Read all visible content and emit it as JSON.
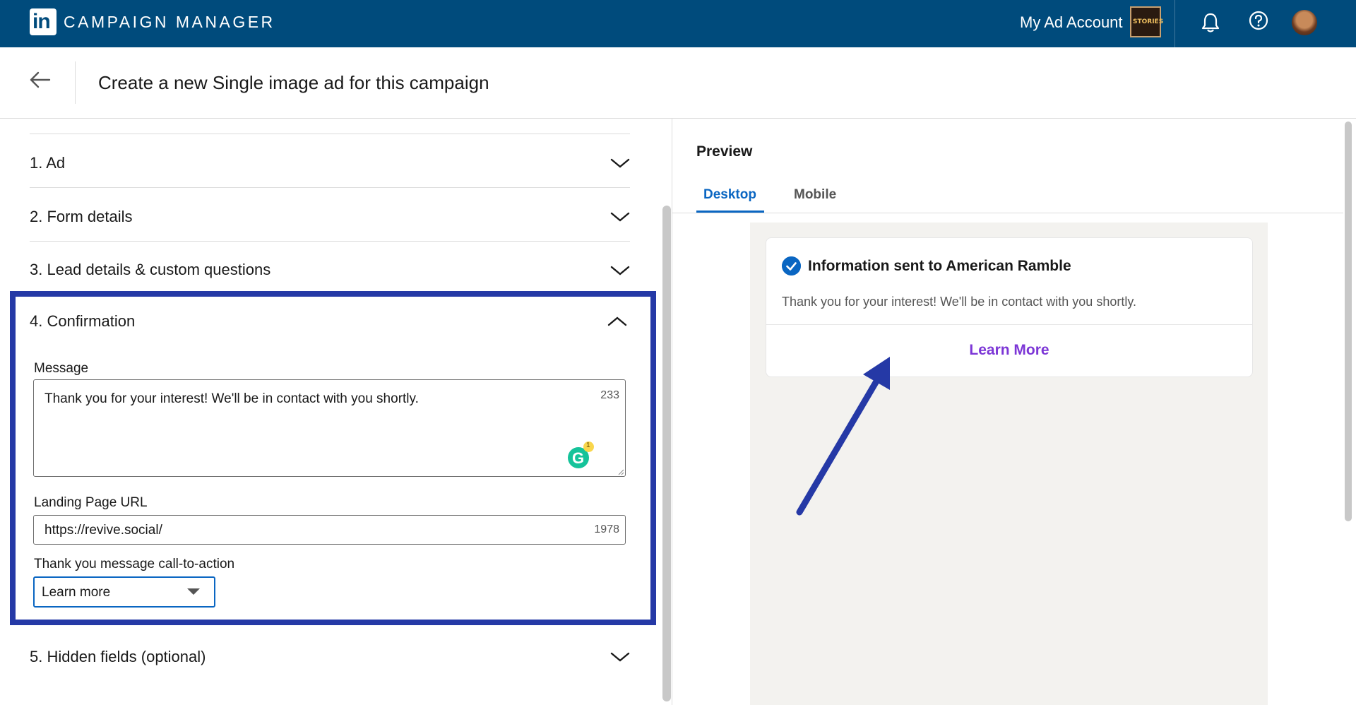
{
  "topbar": {
    "logo_text": "in",
    "app_title": "CAMPAIGN MANAGER",
    "account_label": "My Ad Account",
    "account_thumb_text": "STORIES"
  },
  "header": {
    "title": "Create a new Single image ad for this campaign"
  },
  "sections": {
    "ad": "1.  Ad",
    "form_details": "2.  Form details",
    "lead_details": "3.  Lead details & custom questions",
    "confirmation": "4.  Confirmation",
    "hidden_fields": "5.  Hidden fields (optional)"
  },
  "confirmation": {
    "message_label": "Message",
    "message_value": "Thank you for your interest! We'll be in contact with you shortly.",
    "message_counter": "233",
    "grammarly_letter": "G",
    "grammarly_badge": "1",
    "url_label": "Landing Page URL",
    "url_value": "https://revive.social/",
    "url_counter": "1978",
    "cta_label": "Thank you message call-to-action",
    "cta_value": "Learn more"
  },
  "preview": {
    "title": "Preview",
    "tabs": [
      {
        "label": "Desktop",
        "active": true
      },
      {
        "label": "Mobile",
        "active": false
      }
    ],
    "card": {
      "heading": "Information sent to American Ramble",
      "body": "Thank you for your interest! We'll be in contact with you shortly.",
      "cta": "Learn More"
    }
  },
  "colors": {
    "topbar": "#004b7c",
    "accent": "#0a66c2",
    "highlight_border": "#2539a6",
    "cta_purple": "#7c36d6",
    "arrow": "#2539a6"
  },
  "icons": [
    "back-arrow-icon",
    "bell-icon",
    "help-icon",
    "chevron-down-icon",
    "chevron-up-icon",
    "check-circle-icon",
    "dropdown-caret-icon",
    "grammarly-icon"
  ]
}
